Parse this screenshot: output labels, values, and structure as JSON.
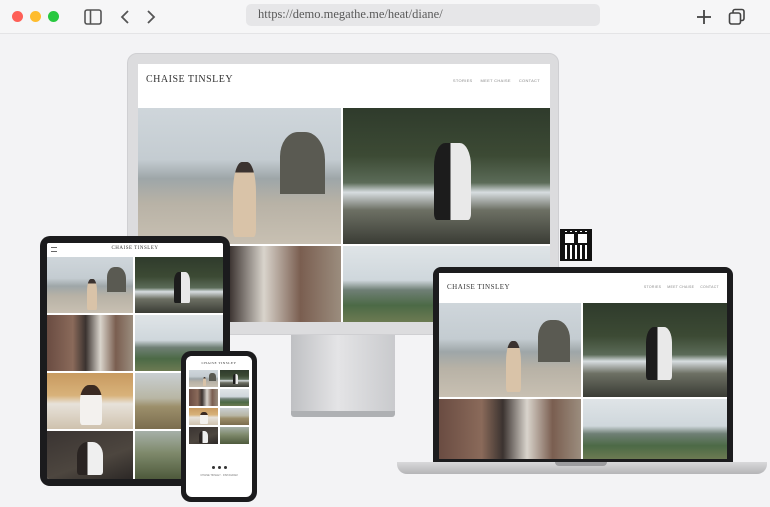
{
  "browser": {
    "url": "https://demo.megathe.me/heat/diane/",
    "icons": [
      "sidebar-icon",
      "back-icon",
      "forward-icon",
      "new-tab-icon",
      "tabs-overview-icon"
    ]
  },
  "site": {
    "logo": "CHAISE TINSLEY",
    "nav": [
      "STORIES",
      "MEET CHAISE",
      "CONTACT"
    ],
    "phone_footer": "CHAISE TINSLEY · INSTAGRAM"
  }
}
